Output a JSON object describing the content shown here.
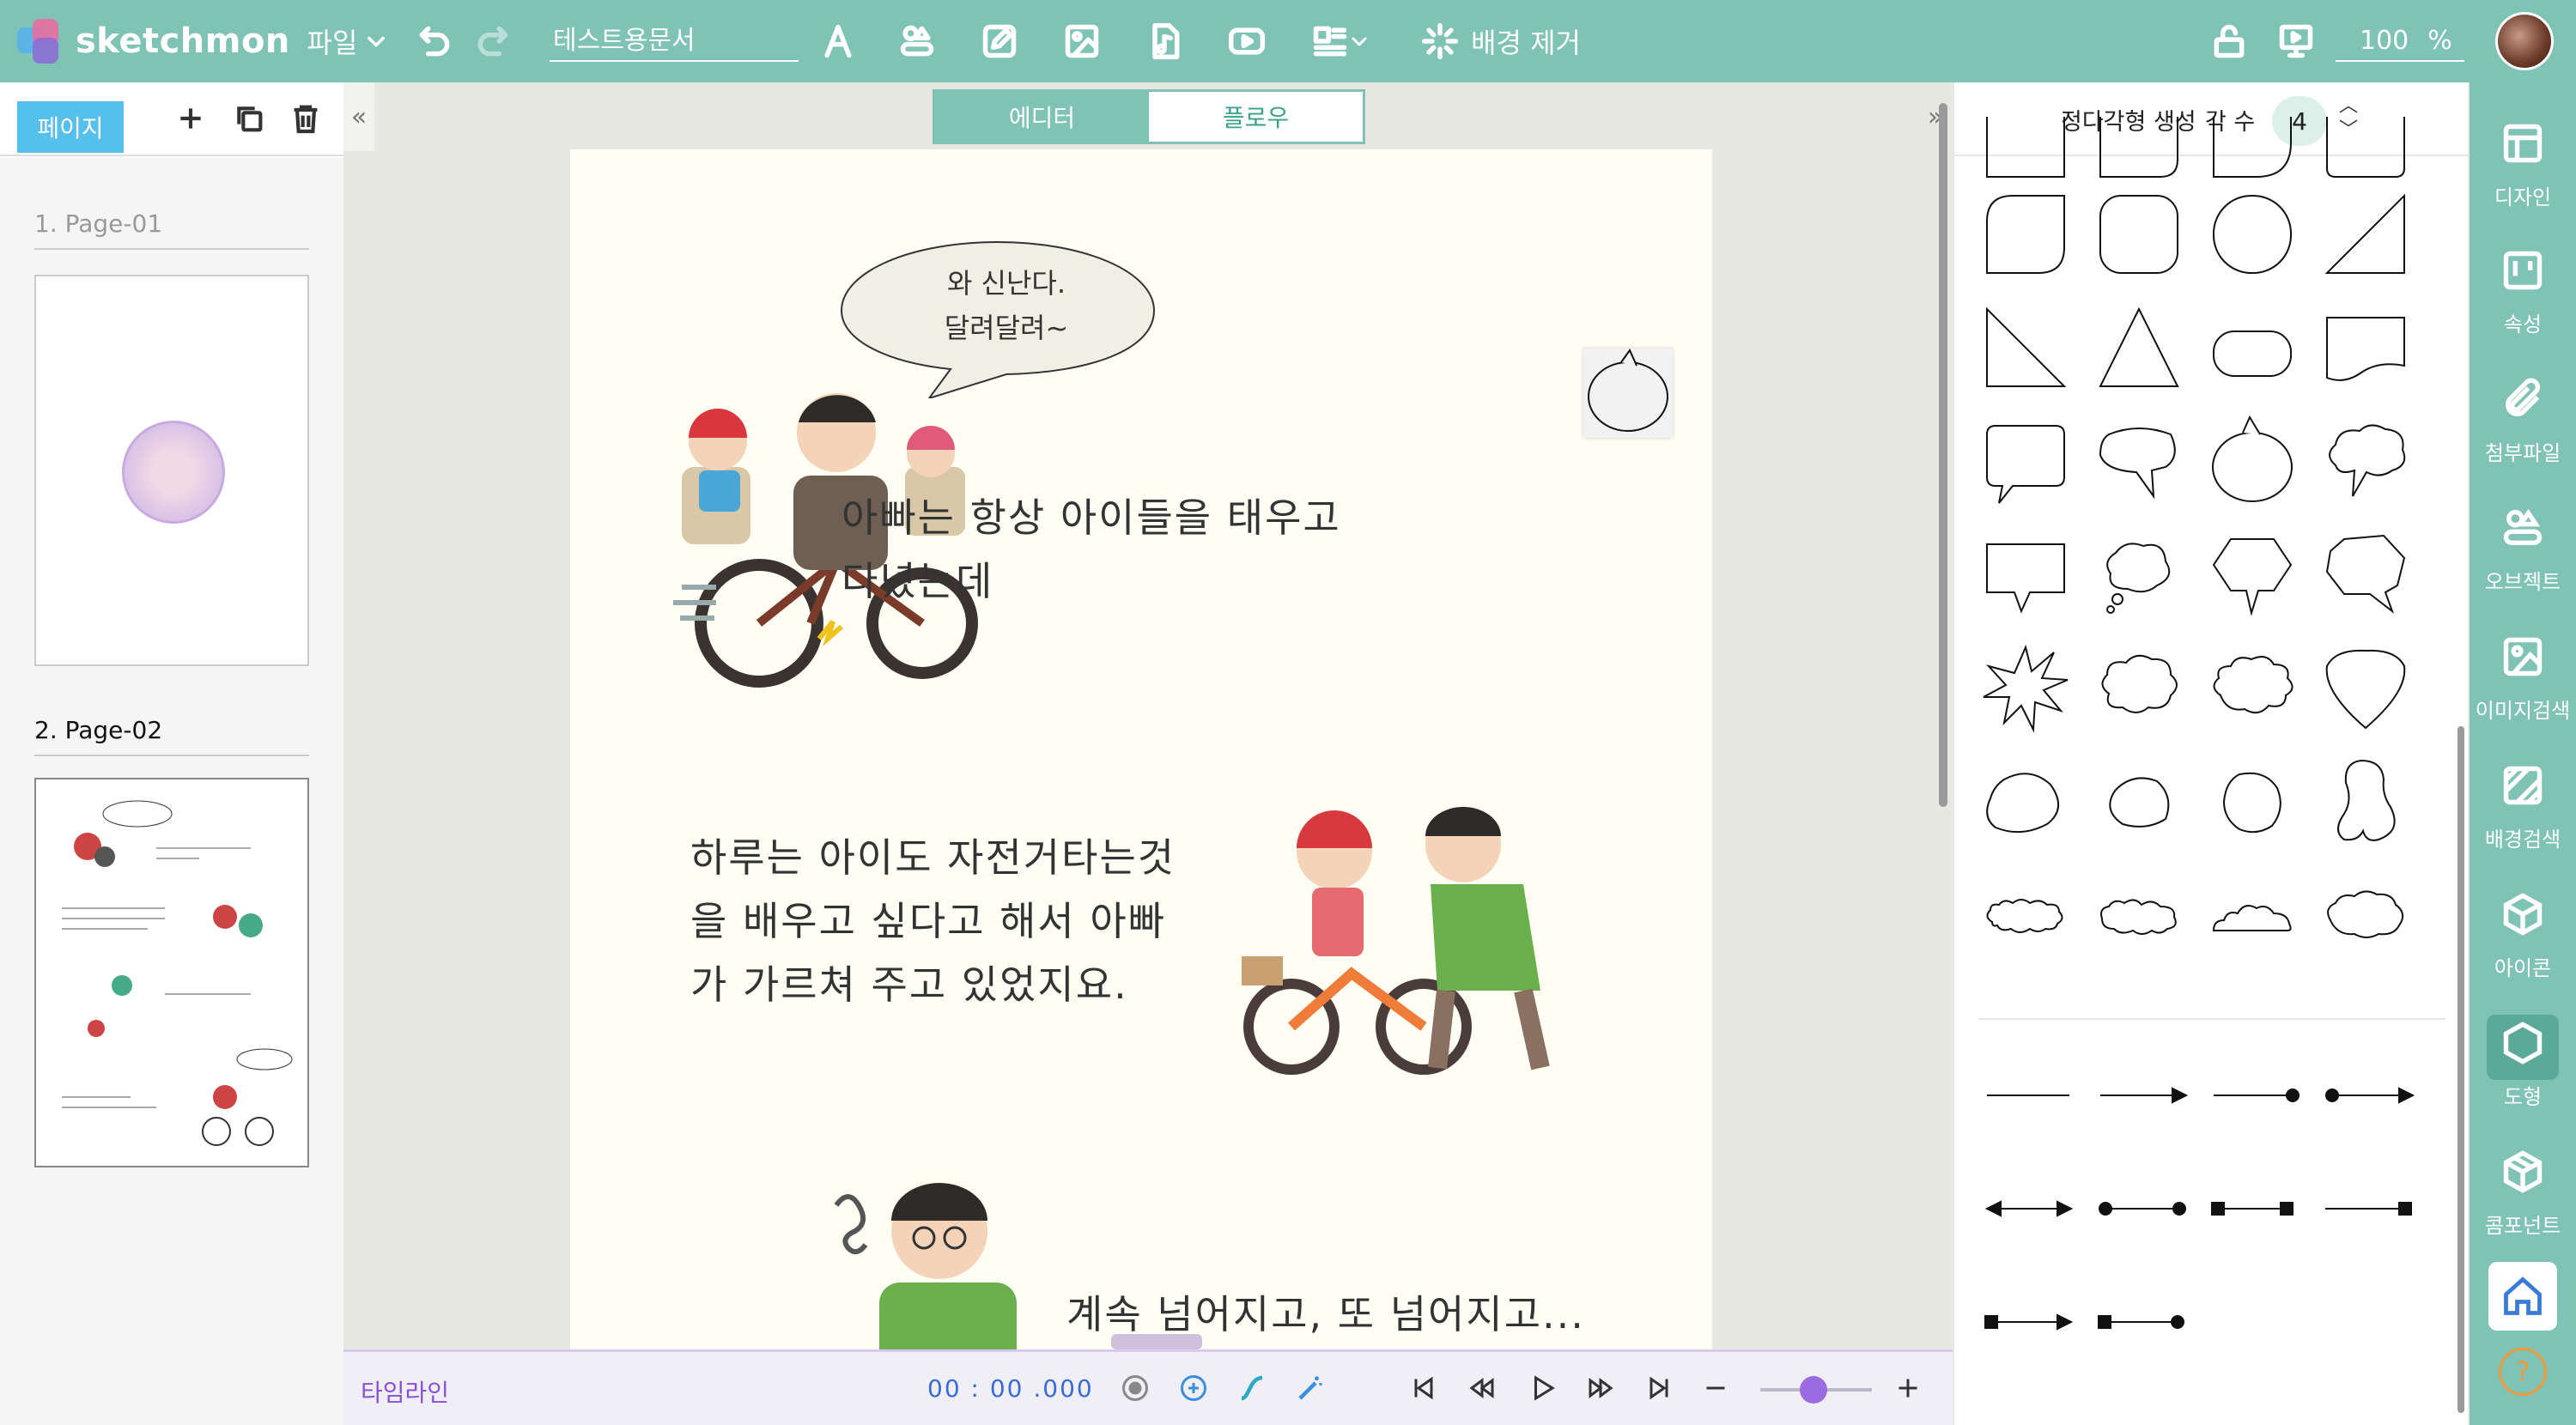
{
  "app": {
    "name": "sketchmon"
  },
  "toolbar": {
    "file_menu": "파일",
    "doc_name": "테스트용문서",
    "remove_bg": "배경 제거",
    "zoom_value": "100",
    "zoom_unit": "%"
  },
  "pages_panel": {
    "tab_label": "페이지",
    "pages": [
      {
        "label": "1. Page-01"
      },
      {
        "label": "2. Page-02"
      }
    ]
  },
  "mode_tabs": {
    "editor": "에디터",
    "flow": "플로우"
  },
  "canvas": {
    "bubble_line1": "와 신난다.",
    "bubble_line2": "달려달려~",
    "text1_line1": "아빠는 항상 아이들을 태우고",
    "text1_line2": "다녔는데",
    "text2_line1": "하루는 아이도 자전거타는것",
    "text2_line2": "을 배우고 싶다고 해서 아빠",
    "text2_line3": "가 가르쳐 주고 있었지요.",
    "text3": "계속 넘어지고, 또 넘어지고..."
  },
  "timeline": {
    "label": "타임라인",
    "time": "00 : 00 .000"
  },
  "shapes_panel": {
    "title": "정다각형 생성",
    "sides_label": "각 수",
    "sides_value": "4"
  },
  "sidenav": {
    "items": [
      {
        "label": "디자인",
        "icon": "layout-icon"
      },
      {
        "label": "속성",
        "icon": "properties-icon"
      },
      {
        "label": "첨부파일",
        "icon": "paperclip-icon"
      },
      {
        "label": "오브젝트",
        "icon": "object-icon"
      },
      {
        "label": "이미지검색",
        "icon": "image-search-icon"
      },
      {
        "label": "배경검색",
        "icon": "background-search-icon"
      },
      {
        "label": "아이콘",
        "icon": "cube-icon"
      },
      {
        "label": "도형",
        "icon": "hexagon-icon"
      },
      {
        "label": "콤포넌트",
        "icon": "component-icon"
      }
    ]
  },
  "colors": {
    "accent": "#7fc3b5",
    "tab_blue": "#55c0ec",
    "timeline_purple": "#8a4fd8"
  }
}
